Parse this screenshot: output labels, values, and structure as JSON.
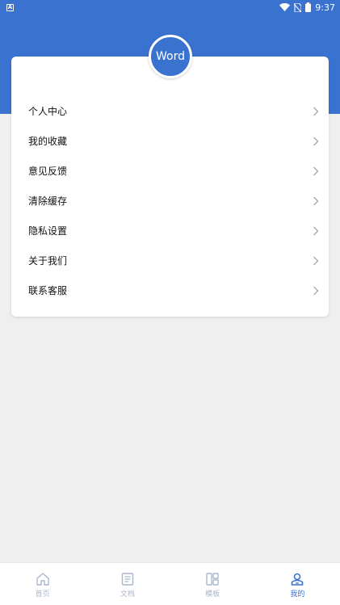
{
  "status_bar": {
    "app_icon_letter": "A",
    "time": "9:37"
  },
  "logo": {
    "text": "Word"
  },
  "menu": [
    {
      "label": "个人中心",
      "icon": "chevron-right-icon"
    },
    {
      "label": "我的收藏",
      "icon": "chevron-right-icon"
    },
    {
      "label": "意见反馈",
      "icon": "chevron-right-icon"
    },
    {
      "label": "清除缓存",
      "icon": "chevron-right-icon"
    },
    {
      "label": "隐私设置",
      "icon": "chevron-right-icon"
    },
    {
      "label": "关于我们",
      "icon": "chevron-right-icon"
    },
    {
      "label": "联系客服",
      "icon": "chevron-right-icon"
    }
  ],
  "tabs": [
    {
      "label": "首页",
      "icon": "home-icon",
      "active": false
    },
    {
      "label": "文档",
      "icon": "document-icon",
      "active": false
    },
    {
      "label": "模板",
      "icon": "template-icon",
      "active": false
    },
    {
      "label": "我的",
      "icon": "profile-icon",
      "active": true
    }
  ],
  "colors": {
    "brand": "#3a73cf",
    "background": "#efefef",
    "tab_inactive": "#a9b6cc"
  }
}
